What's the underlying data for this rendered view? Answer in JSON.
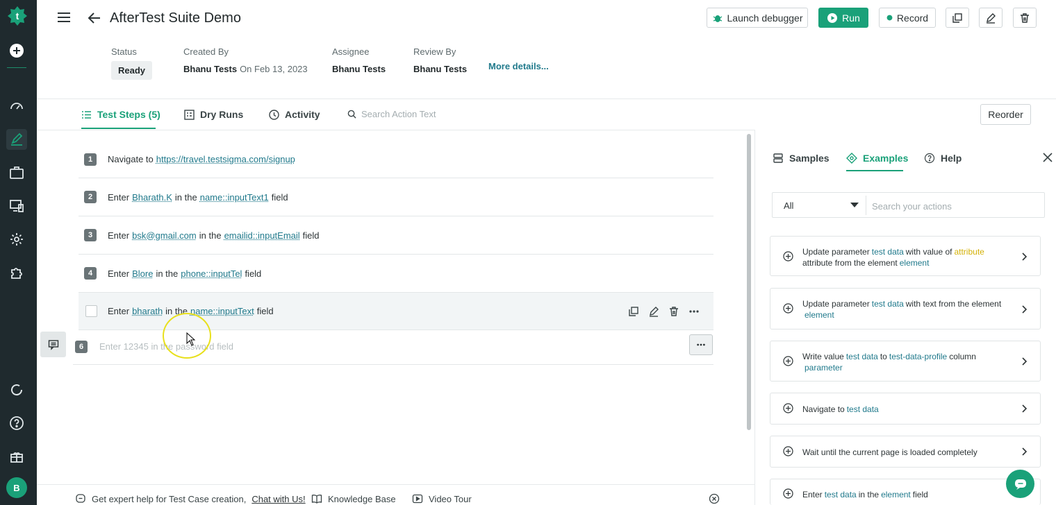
{
  "header": {
    "title": "AfterTest Suite Demo",
    "launch_debugger": "Launch debugger",
    "run": "Run",
    "record": "Record"
  },
  "meta": {
    "status_label": "Status",
    "status_value": "Ready",
    "created_label": "Created By",
    "created_by": "Bhanu Tests",
    "created_on": "On Feb 13, 2023",
    "assignee_label": "Assignee",
    "assignee": "Bhanu Tests",
    "review_label": "Review By",
    "reviewer": "Bhanu Tests",
    "more_details": "More details..."
  },
  "tabs": {
    "steps": "Test Steps (5)",
    "dry_runs": "Dry Runs",
    "activity": "Activity",
    "search_placeholder": "Search Action Text",
    "reorder": "Reorder"
  },
  "steps": [
    {
      "num": "1",
      "parts": [
        "Navigate to",
        "https://travel.testsigma.com/signup"
      ]
    },
    {
      "num": "2",
      "parts": [
        "Enter",
        "Bharath.K",
        "in the",
        "name::inputText1",
        "field"
      ]
    },
    {
      "num": "3",
      "parts": [
        "Enter",
        "bsk@gmail.com",
        "in the",
        "emailid::inputEmail",
        "field"
      ]
    },
    {
      "num": "4",
      "parts": [
        "Enter",
        "Blore",
        "in the",
        "phone::inputTel",
        "field"
      ]
    },
    {
      "num": "5",
      "parts": [
        "Enter",
        "bharath",
        "in the",
        "name::inputText",
        "field"
      ]
    }
  ],
  "new_step": {
    "num": "6",
    "placeholder": "Enter 12345 in the password field"
  },
  "panel": {
    "tabs": [
      "Samples",
      "Examples",
      "Help"
    ],
    "filter_value": "All",
    "search_placeholder": "Search your actions",
    "cards": [
      {
        "parts": [
          "Update parameter",
          "test data",
          "with value of",
          "attribute",
          "attribute from the element",
          "element"
        ]
      },
      {
        "parts": [
          "Update parameter",
          "test data",
          "with text from the element",
          "element"
        ]
      },
      {
        "parts": [
          "Write value",
          "test data",
          "to",
          "test-data-profile",
          "column",
          "parameter"
        ]
      },
      {
        "parts": [
          "Navigate to",
          "test data"
        ]
      },
      {
        "parts": [
          "Wait until the current page is loaded completely"
        ]
      },
      {
        "parts": [
          "Enter",
          "test data",
          "in the",
          "element",
          "field"
        ]
      }
    ]
  },
  "footer": {
    "help_text": "Get expert help for Test Case creation,",
    "chat_link": "Chat with Us!",
    "knowledge_base": "Knowledge Base",
    "video_tour": "Video Tour"
  },
  "user": {
    "initial": "B"
  },
  "colors": {
    "accent": "#1aa179",
    "param": "#217a8c",
    "attr": "#d4b107",
    "rail": "#1f2a2e"
  }
}
